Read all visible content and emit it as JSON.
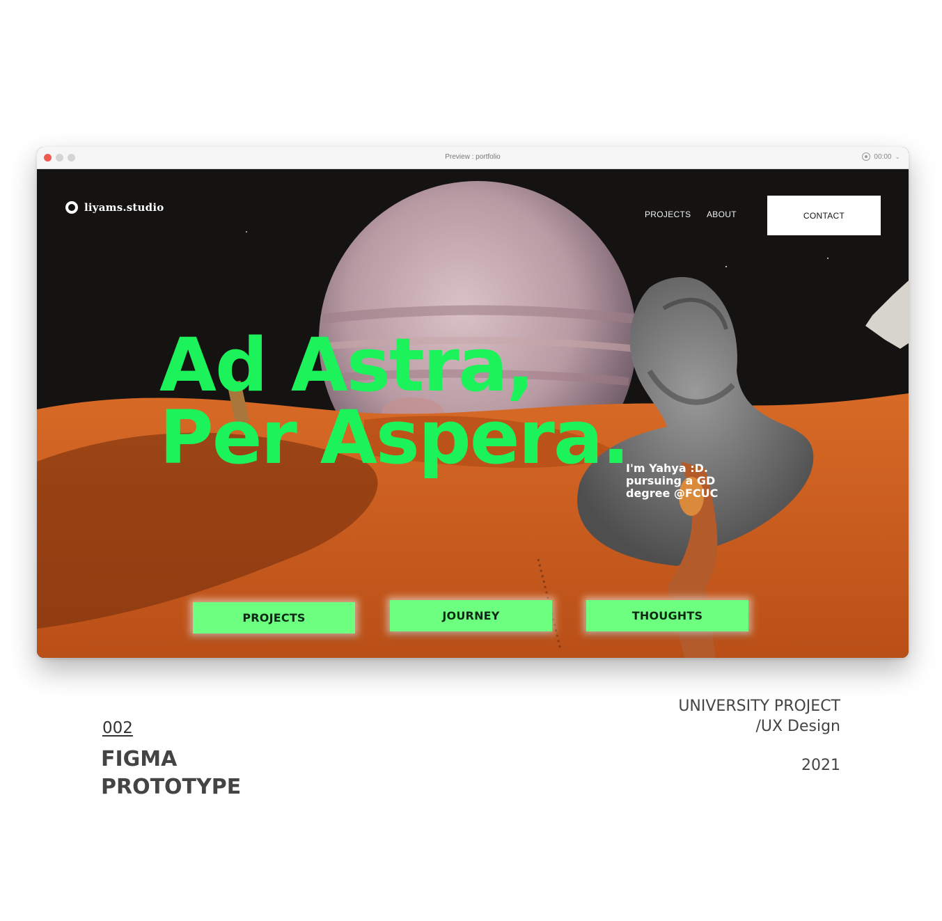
{
  "window": {
    "title": "Preview : portfolio",
    "timer": "00:00"
  },
  "site": {
    "logo_text": "liyams.studio",
    "nav": {
      "projects": "PROJECTS",
      "about": "ABOUT",
      "contact": "CONTACT"
    },
    "headline_line1": "Ad Astra,",
    "headline_line2": "Per Aspera.",
    "bio_line1": "I'm Yahya :D.",
    "bio_line2": "pursuing a GD",
    "bio_line3": "degree @FCUC",
    "buttons": {
      "projects": "PROJECTS",
      "journey": "JOURNEY",
      "thoughts": "THOUGHTS"
    }
  },
  "caption": {
    "number": "002",
    "title_line1": "FIGMA",
    "title_line2": "PROTOTYPE",
    "category_line1": "UNIVERSITY PROJECT",
    "category_line2": "/UX Design",
    "year": "2021"
  },
  "colors": {
    "accent_green": "#1cf25a",
    "button_green": "#6dff7f",
    "sand": "#c9571c",
    "space": "#111111"
  }
}
